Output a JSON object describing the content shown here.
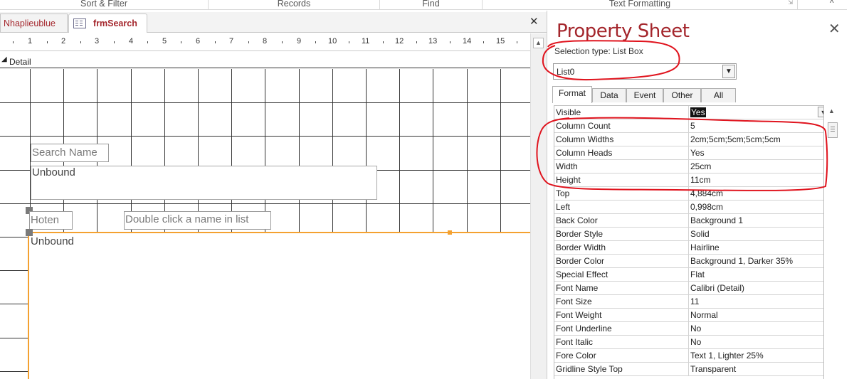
{
  "ribbon": {
    "groups": [
      "Sort & Filter",
      "Records",
      "Find",
      "Text Formatting"
    ]
  },
  "document_tabs": [
    {
      "label": "Nhaplieublue",
      "active": false
    },
    {
      "label": "frmSearch",
      "active": true
    }
  ],
  "ruler": {
    "numbers": [
      "1",
      "2",
      "3",
      "4",
      "5",
      "6",
      "7",
      "8",
      "9",
      "10",
      "11",
      "12",
      "13",
      "14",
      "15"
    ]
  },
  "section": {
    "label": "Detail"
  },
  "design": {
    "controls": {
      "search_name_label": "Search Name",
      "textbox_unbound": "Unbound",
      "hoten_label": "Hoten",
      "double_click_label": "Double click a name in list",
      "listbox_unbound": "Unbound"
    }
  },
  "property_sheet": {
    "title": "Property Sheet",
    "selection_type": "Selection type:  List Box",
    "object_combo_value": "List0",
    "tabs": [
      "Format",
      "Data",
      "Event",
      "Other",
      "All"
    ],
    "active_tab": "Format",
    "properties": [
      {
        "name": "Visible",
        "value": "Yes"
      },
      {
        "name": "Column Count",
        "value": "5"
      },
      {
        "name": "Column Widths",
        "value": "2cm;5cm;5cm;5cm;5cm"
      },
      {
        "name": "Column Heads",
        "value": "Yes"
      },
      {
        "name": "Width",
        "value": "25cm"
      },
      {
        "name": "Height",
        "value": "11cm"
      },
      {
        "name": "Top",
        "value": "4,884cm"
      },
      {
        "name": "Left",
        "value": "0,998cm"
      },
      {
        "name": "Back Color",
        "value": "Background 1"
      },
      {
        "name": "Border Style",
        "value": "Solid"
      },
      {
        "name": "Border Width",
        "value": "Hairline"
      },
      {
        "name": "Border Color",
        "value": "Background 1, Darker 35%"
      },
      {
        "name": "Special Effect",
        "value": "Flat"
      },
      {
        "name": "Font Name",
        "value": "Calibri (Detail)"
      },
      {
        "name": "Font Size",
        "value": "11"
      },
      {
        "name": "Font Weight",
        "value": "Normal"
      },
      {
        "name": "Font Underline",
        "value": "No"
      },
      {
        "name": "Font Italic",
        "value": "No"
      },
      {
        "name": "Fore Color",
        "value": "Text 1, Lighter 25%"
      },
      {
        "name": "Gridline Style Top",
        "value": "Transparent"
      }
    ]
  },
  "colors": {
    "accent_red": "#a4262c",
    "annotation_red": "#e0141e",
    "selection_orange": "#f4a130"
  },
  "icons": [
    "form-icon",
    "close-icon",
    "chevron-down-icon",
    "dialog-launcher-icon",
    "section-collapse-icon",
    "scroll-up-icon"
  ]
}
